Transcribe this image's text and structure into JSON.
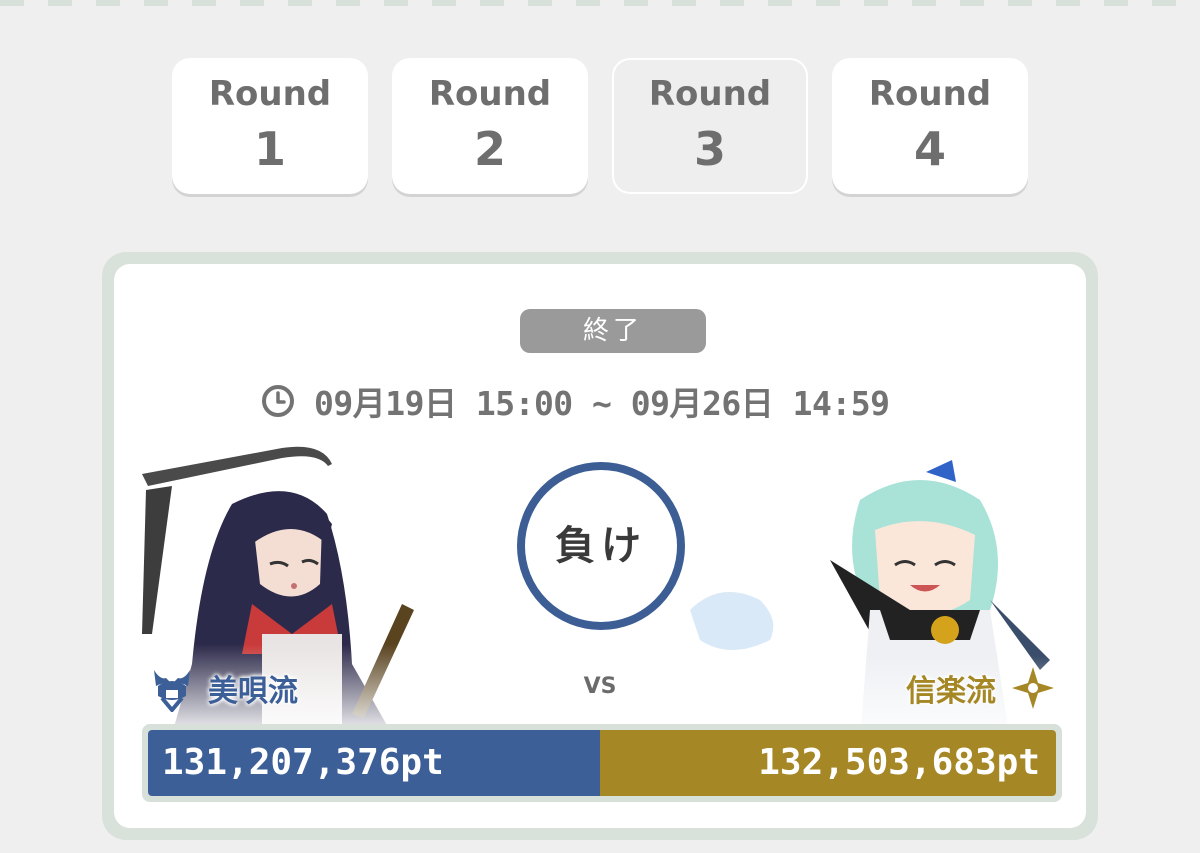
{
  "rounds": [
    {
      "label": "Round",
      "number": "1"
    },
    {
      "label": "Round",
      "number": "2"
    },
    {
      "label": "Round",
      "number": "3"
    },
    {
      "label": "Round",
      "number": "4"
    }
  ],
  "selected_round": "3",
  "battle": {
    "status": "終了",
    "period": "09月19日 15:00 ~ 09月26日 14:59",
    "result": "負け",
    "vs": "VS",
    "left_team": {
      "name": "美唄流",
      "score": "131,207,376pt",
      "score_value": 131207376,
      "color": "#3d5f98",
      "emblem": "samurai-helmet-icon"
    },
    "right_team": {
      "name": "信楽流",
      "score": "132,503,683pt",
      "score_value": 132503683,
      "color": "#a68726",
      "emblem": "shuriken-icon"
    }
  },
  "colors": {
    "background": "#efefef",
    "card_border": "#d8e2da",
    "result_ring": "#3c5e95",
    "status_badge": "#9a9a9a"
  }
}
